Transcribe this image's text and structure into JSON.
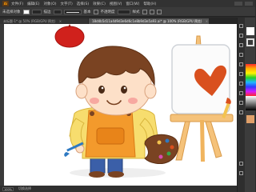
{
  "app": {
    "logo": "Ai"
  },
  "menu": [
    "文件(F)",
    "编辑(E)",
    "对象(O)",
    "文字(T)",
    "选择(S)",
    "效果(C)",
    "视图(V)",
    "窗口(W)",
    "帮助(H)"
  ],
  "control_bar": {
    "selection_label": "未选择对象",
    "stroke_label": "描边",
    "stroke_style": "基本",
    "opacity_label": "不透明度",
    "style_label": "样式"
  },
  "tabs": [
    {
      "label": "未标题-1* @ 50% (RGB/GPU 预览)",
      "close": "×"
    },
    {
      "label": "18d4b5d11a4d9d3e6d6c1e8b9d3e5a93.ai* @ 100% (RGB/GPU 预览)",
      "close": "×"
    }
  ],
  "status": {
    "zoom": "100%",
    "text": "切换选择"
  },
  "colors": {
    "canvas": "#ffffff",
    "chrome": "#323232",
    "accent_heart": "#d9501e"
  }
}
